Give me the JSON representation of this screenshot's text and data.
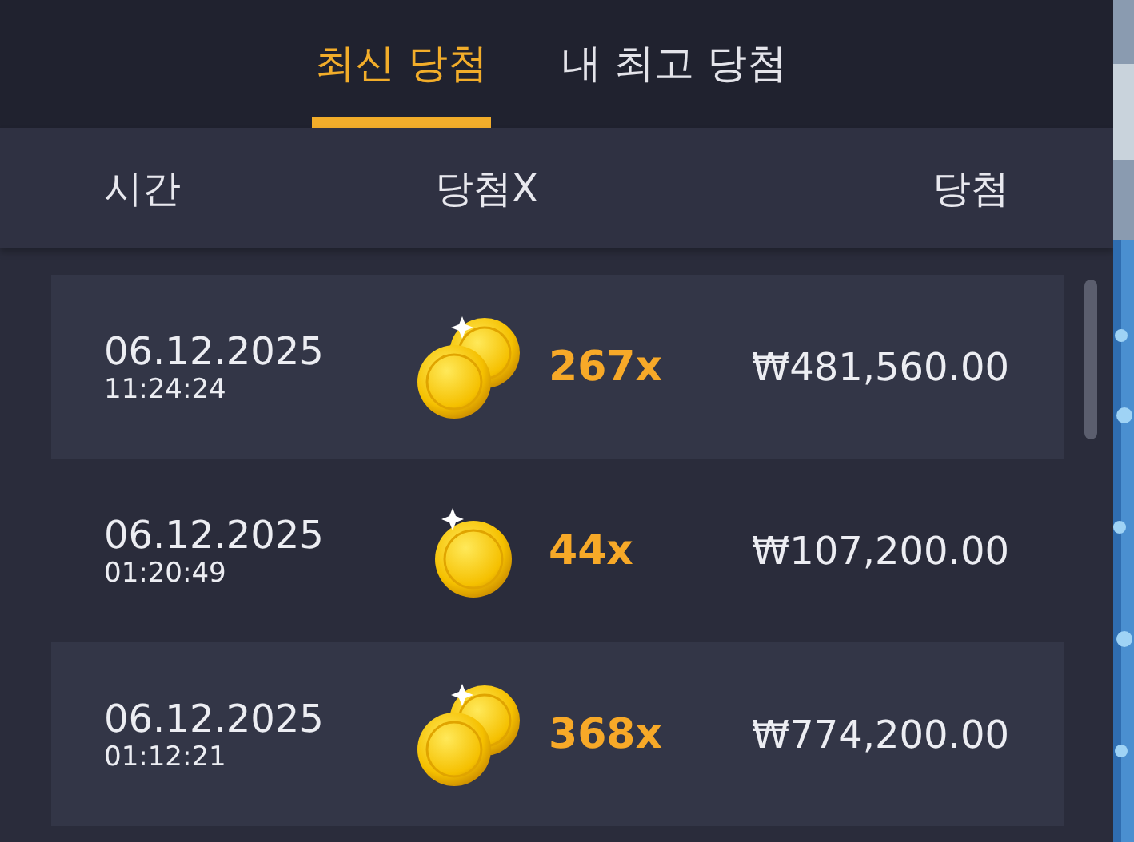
{
  "tabs": [
    {
      "label": "최신 당첨",
      "selected": true
    },
    {
      "label": "내 최고 당첨",
      "selected": false
    }
  ],
  "columns": [
    "시간",
    "당첨X",
    "당첨"
  ],
  "rows": [
    {
      "date": "06.12.2025",
      "time": "11:24:24",
      "kind": "double",
      "multiplier": "267x",
      "amount": "₩481,560.00"
    },
    {
      "date": "06.12.2025",
      "time": "01:20:49",
      "kind": "single",
      "multiplier": "44x",
      "amount": "₩107,200.00"
    },
    {
      "date": "06.12.2025",
      "time": "01:12:21",
      "kind": "double",
      "multiplier": "368x",
      "amount": "₩774,200.00"
    }
  ]
}
